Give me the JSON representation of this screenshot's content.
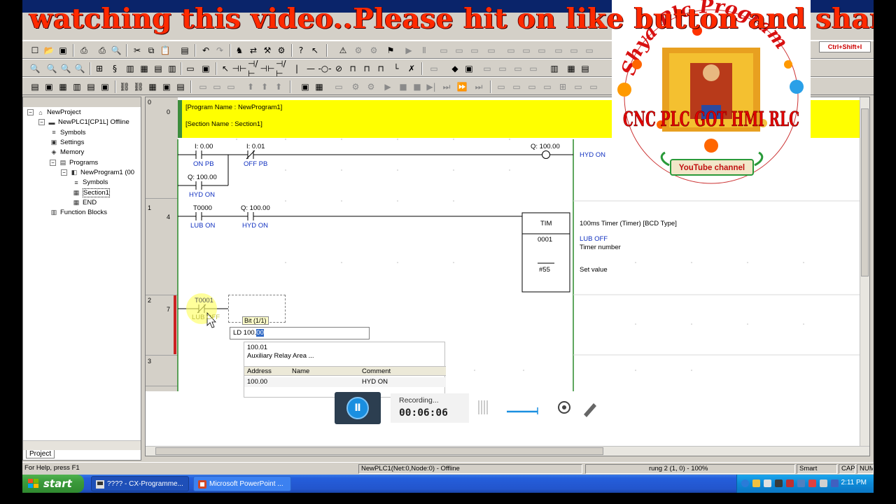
{
  "banner": {
    "text": "watching this video..Please hit on like button and shar"
  },
  "toolbar": {
    "shortcut_hint": "Ctrl+Shift+I"
  },
  "project_tree": {
    "items": [
      {
        "label": "NewProject",
        "icon": "project-icon",
        "level": 0
      },
      {
        "label": "NewPLC1[CP1L] Offline",
        "icon": "plc-icon",
        "level": 1
      },
      {
        "label": "Symbols",
        "icon": "symbols-icon",
        "level": 2
      },
      {
        "label": "Settings",
        "icon": "settings-icon",
        "level": 2
      },
      {
        "label": "Memory",
        "icon": "memory-icon",
        "level": 2
      },
      {
        "label": "Programs",
        "icon": "programs-icon",
        "level": 2
      },
      {
        "label": "NewProgram1 (00",
        "icon": "program-icon",
        "level": 3
      },
      {
        "label": "Symbols",
        "icon": "symbols-icon",
        "level": 4
      },
      {
        "label": "Section1",
        "icon": "section-icon",
        "level": 4
      },
      {
        "label": "END",
        "icon": "section-icon",
        "level": 4
      },
      {
        "label": "Function Blocks",
        "icon": "function-blocks-icon",
        "level": 2
      }
    ],
    "tab_label": "Project"
  },
  "ladder": {
    "program_name": "[Program Name : NewProgram1]",
    "section_name": "[Section Name : Section1]",
    "rungs": [
      {
        "num": "0",
        "step": "0"
      },
      {
        "num": "1",
        "step": "4"
      },
      {
        "num": "2",
        "step": "7"
      },
      {
        "num": "3",
        "step": ""
      }
    ],
    "r0": {
      "c1_addr": "I: 0.00",
      "c1_cmt": "ON PB",
      "c2_addr": "I: 0.01",
      "c2_cmt": "OFF PB",
      "c3_addr": "Q: 100.00",
      "c3_cmt": "HYD ON",
      "coil_addr": "Q: 100.00",
      "coil_cmt": "HYD ON"
    },
    "r1": {
      "c1_addr": "T0000",
      "c1_cmt": "LUB ON",
      "c2_addr": "Q: 100.00",
      "c2_cmt": "HYD ON",
      "tim_name": "TIM",
      "tim_num": "0001",
      "tim_set": "#55",
      "tim_desc": "100ms Timer (Timer) [BCD Type]",
      "tim_comment": "LUB OFF",
      "tim_num_label": "Timer number",
      "tim_set_label": "Set value"
    },
    "r2": {
      "c1_addr": "T0001",
      "c1_cmt": "LUB OFF"
    }
  },
  "instruction_popup": {
    "bit_tag": "Bit (1/1)",
    "input_prefix": "LD 100.",
    "input_selected": "00",
    "suggest_addr": "100.01",
    "suggest_area": "Auxiliary Relay Area ...",
    "columns": [
      "Address",
      "Name",
      "Comment"
    ],
    "row": {
      "address": "100.00",
      "name": "",
      "comment": "HYD ON"
    }
  },
  "recording": {
    "status": "Recording...",
    "time": "00:06:06"
  },
  "statusbar": {
    "help": "For Help, press F1",
    "plc": "NewPLC1(Net:0,Node:0) - Offline",
    "rung": "rung 2 (1, 0)  - 100%",
    "mode": "Smart",
    "cap": "CAP",
    "num": "NUM"
  },
  "taskbar": {
    "start": "start",
    "tasks": [
      {
        "label": "???? - CX-Programme..."
      },
      {
        "label": "Microsoft PowerPoint ..."
      }
    ],
    "time": "2:11 PM"
  },
  "logo": {
    "arc_text": "Shya Plc Program",
    "main_text": "CNC PLC GOT HMI RLC",
    "badge": "YouTube channel"
  },
  "colors": {
    "accent_yellow": "#ffff00",
    "comment_blue": "#1030c0",
    "banner_red": "#ff2a00",
    "logo_red": "#e00000"
  }
}
